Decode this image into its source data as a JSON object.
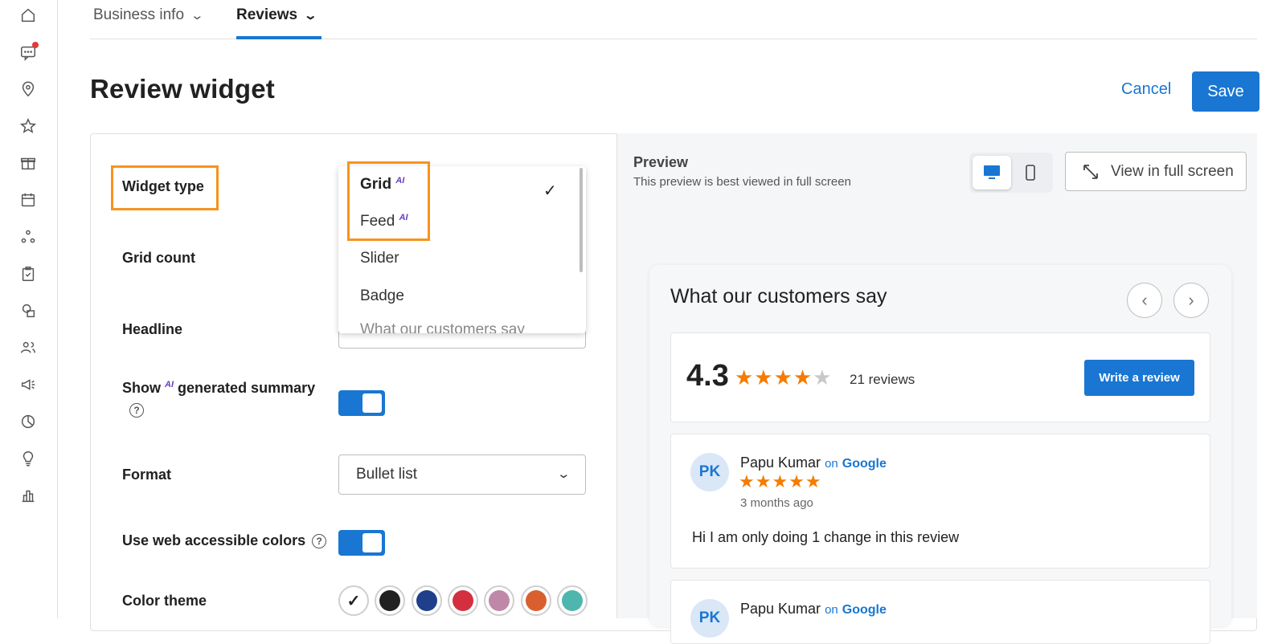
{
  "sidebar": {
    "icons": [
      "home-icon",
      "messages-icon",
      "location-icon",
      "star-icon",
      "gift-icon",
      "calendar-icon",
      "network-icon",
      "clipboard-check-icon",
      "shapes-icon",
      "people-icon",
      "megaphone-icon",
      "pie-chart-icon",
      "lightbulb-icon",
      "bar-chart-icon"
    ]
  },
  "tabs": [
    {
      "label": "Business info",
      "active": false
    },
    {
      "label": "Reviews",
      "active": true
    }
  ],
  "page": {
    "title": "Review widget",
    "cancel_label": "Cancel",
    "save_label": "Save"
  },
  "settings": {
    "widget_type_label": "Widget type",
    "grid_count_label": "Grid count",
    "headline_label": "Headline",
    "show_summary_prefix": "Show",
    "ai_badge": "AI",
    "show_summary_suffix": "generated summary",
    "format_label": "Format",
    "format_value": "Bullet list",
    "accessible_colors_label": "Use web accessible colors",
    "color_theme_label": "Color theme",
    "help_glyph": "?",
    "dropdown": {
      "options": [
        "Grid",
        "Feed",
        "Slider",
        "Badge"
      ],
      "selected": "Grid",
      "partial_text": "What our customers say"
    },
    "swatches": [
      "#ffffff",
      "#212121",
      "#1f3f8a",
      "#d32f3f",
      "#c088a8",
      "#d9602e",
      "#4fb6ad"
    ]
  },
  "preview": {
    "title": "Preview",
    "subtitle": "This preview is best viewed in full screen",
    "fullscreen_label": "View in full screen",
    "widget": {
      "headline": "What our customers say",
      "rating": "4.3",
      "reviews_count": "21 reviews",
      "write_review_label": "Write a review",
      "reviews": [
        {
          "initials": "PK",
          "name": "Papu Kumar",
          "on": "on",
          "source": "Google",
          "time": "3 months ago",
          "text": "Hi I am only doing 1 change in this review"
        },
        {
          "initials": "PK",
          "name": "Papu Kumar",
          "on": "on",
          "source": "Google"
        }
      ]
    }
  },
  "colors": {
    "accent": "#1976d2",
    "highlight": "#f7931e",
    "star": "#f57c00"
  }
}
